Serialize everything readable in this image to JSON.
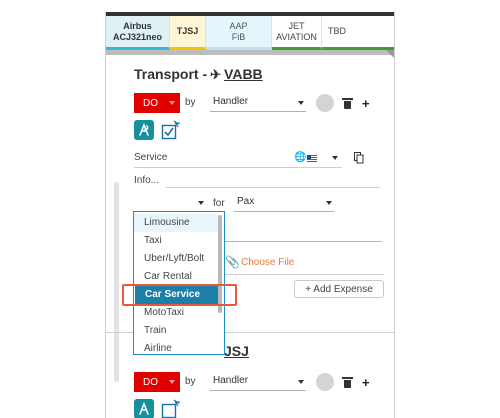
{
  "tabs": {
    "aircraft": {
      "line1": "Airbus",
      "line2": "ACJ321neo"
    },
    "airport": "TJSJ",
    "fbo": {
      "line1": "AAP",
      "line2": "FiB"
    },
    "service": {
      "line1": "JET",
      "line2": "AVIATION"
    },
    "tbd": "TBD"
  },
  "transport1": {
    "title_prefix": "Transport -",
    "icao": "VABB",
    "status": "DO",
    "by_label": "by",
    "handler": "Handler",
    "service_label": "Service",
    "info_label": "Info...",
    "for_label": "for",
    "pax": "Pax",
    "choose_file": "Choose File",
    "add_expense": "+ Add Expense"
  },
  "transport_dropdown": {
    "options": [
      "Limousine",
      "Taxi",
      "Uber/Lyft/Bolt",
      "Car Rental",
      "Car Service",
      "MotoTaxi",
      "Train",
      "Airline"
    ],
    "selected": "Car Service",
    "hovered": "Limousine"
  },
  "transport2": {
    "title_visible": "JSJ",
    "status": "DO",
    "by_label": "by",
    "handler": "Handler"
  },
  "colors": {
    "status_red": "#e00000",
    "accent_teal": "#17909e",
    "selected_blue": "#1b7fa8",
    "highlight_orange": "#e8583d",
    "link_orange": "#e57a3c"
  },
  "icons": {
    "plane": "airplane-icon",
    "trash": "trash-icon",
    "add": "plus-icon",
    "teal": "transport-icon",
    "check": "checkbox-plane-icon",
    "globe": "globe-icon",
    "copy": "copy-icon",
    "attach": "paperclip-icon"
  }
}
